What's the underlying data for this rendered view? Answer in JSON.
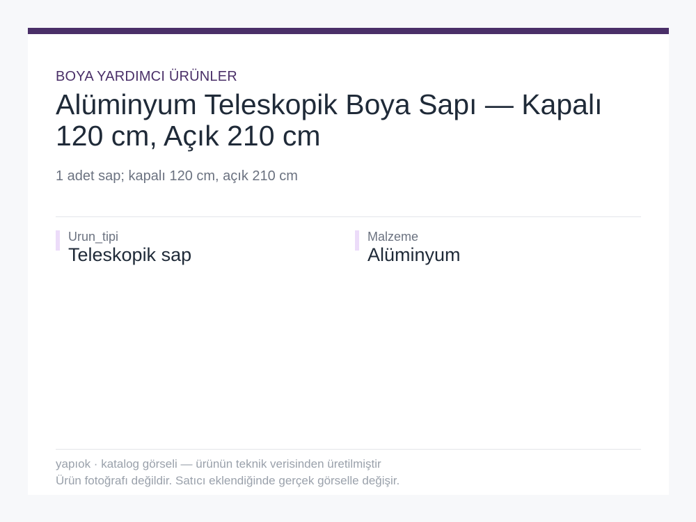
{
  "colors": {
    "accent_bar": "#4a2f68",
    "attr_accent": "#ecdcf9"
  },
  "product": {
    "category": "BOYA YARDIMCI ÜRÜNLER",
    "title": "Alüminyum Teleskopik Boya Sapı — Kapalı 120 cm, Açık 210 cm",
    "subtitle": "1 adet sap; kapalı 120 cm, açık 210 cm"
  },
  "attributes": [
    {
      "label": "Urun_tipi",
      "value": "Teleskopik sap"
    },
    {
      "label": "Malzeme",
      "value": "Alüminyum"
    }
  ],
  "footer": {
    "line1": "yapıok · katalog görseli — ürünün teknik verisinden üretilmiştir",
    "line2": "Ürün fotoğrafı değildir. Satıcı eklendiğinde gerçek görselle değişir."
  }
}
